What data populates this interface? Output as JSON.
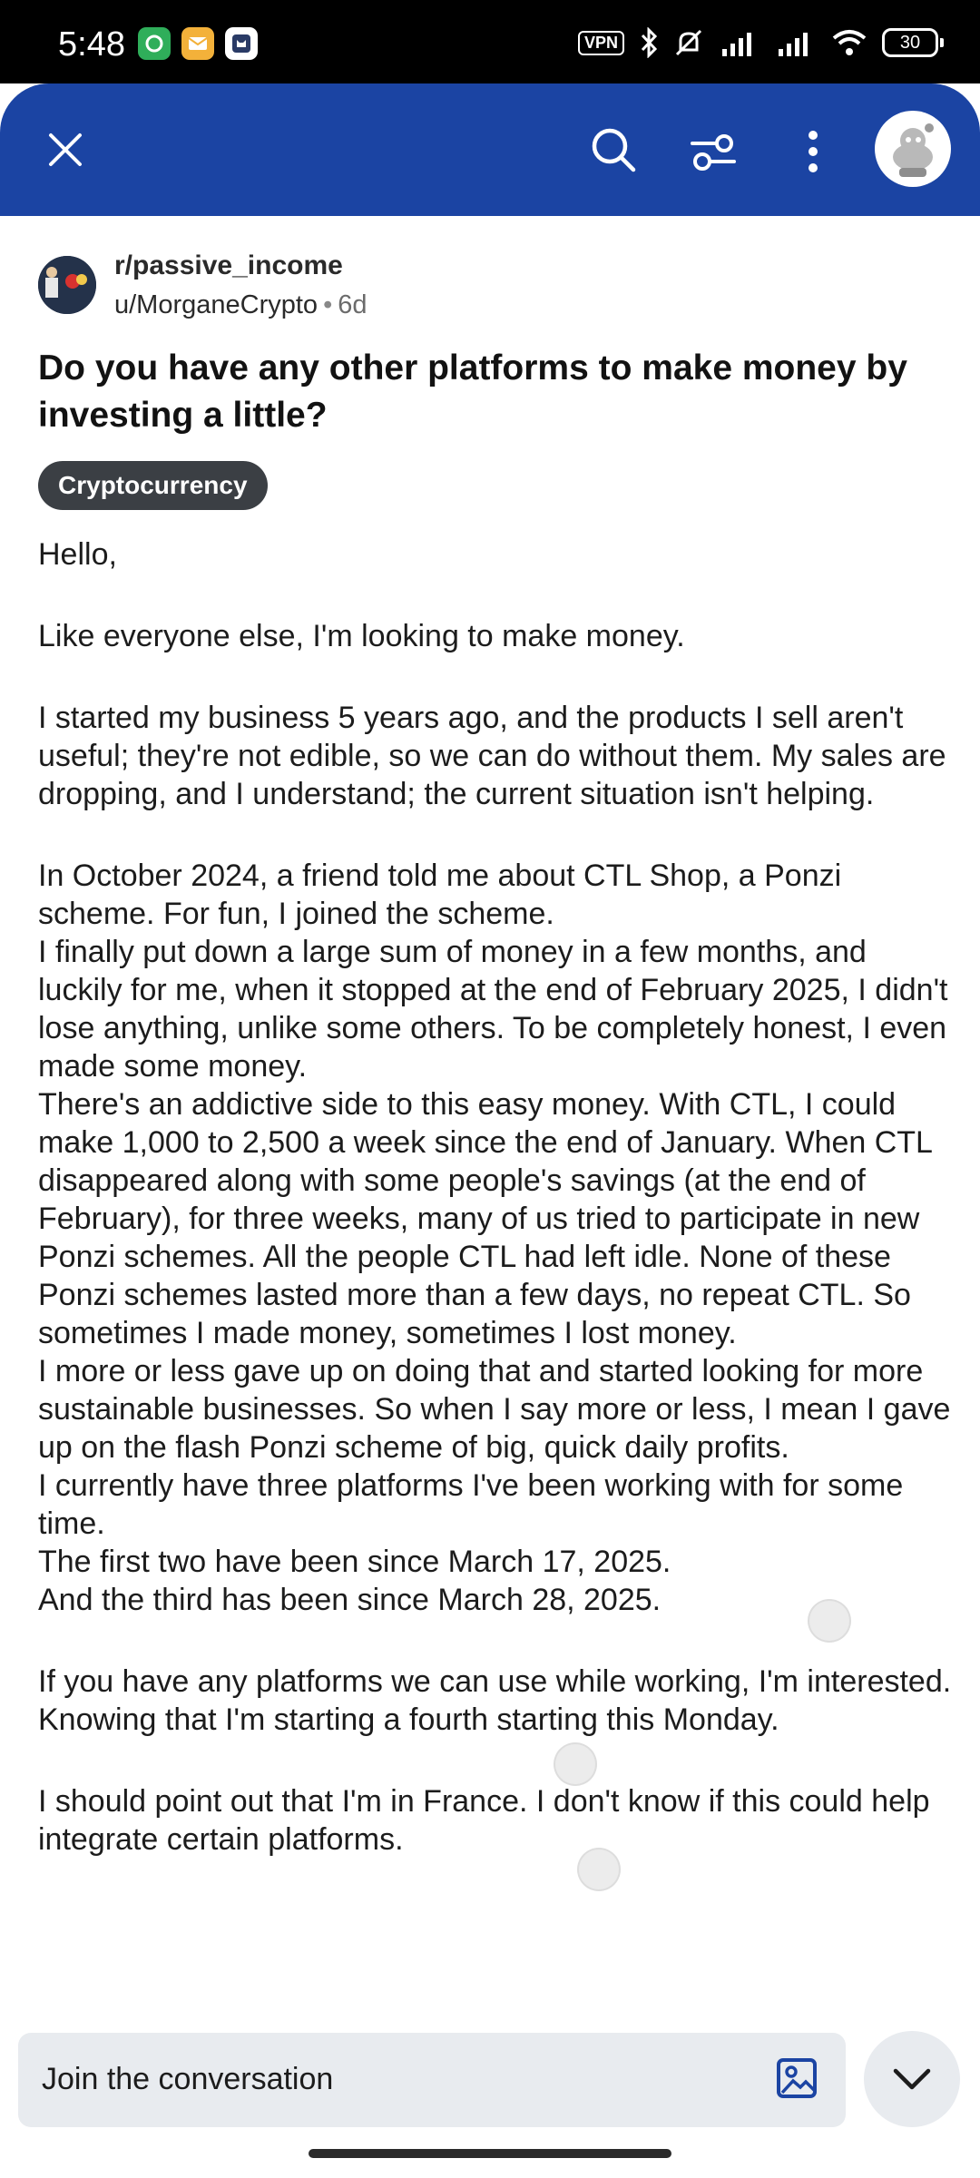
{
  "status_bar": {
    "time": "5:48",
    "vpn_label": "VPN",
    "battery": "30"
  },
  "appbar": {
    "icons": [
      "close-icon",
      "search-icon",
      "filter-icon",
      "more-vertical-icon",
      "avatar-snoo-icon"
    ],
    "color": "#1b44a3"
  },
  "post": {
    "subreddit": "r/passive_income",
    "author": "u/MorganeCrypto",
    "age": "6d",
    "title": "Do you have any other platforms to make money by investing a little?",
    "flair": "Cryptocurrency",
    "paragraphs": [
      "Hello,",
      "Like everyone else, I'm looking to make money.",
      "I started my business 5 years ago, and the products I sell aren't useful; they're not edible, so we can do without them. My sales are dropping, and I understand; the current situation isn't helping.",
      "In October 2024, a friend told me about CTL Shop, a Ponzi scheme. For fun, I joined the scheme.\nI finally put down a large sum of money in a few months, and luckily for me, when it stopped at the end of February 2025, I didn't lose anything, unlike some others. To be completely honest, I even made some money.\nThere's an addictive side to this easy money. With CTL, I could make 1,000 to 2,500 a week since the end of January. When CTL disappeared along with some people's savings (at the end of February), for three weeks, many of us tried to participate in new Ponzi schemes. All the people CTL had left idle. None of these Ponzi schemes lasted more than a few days, no repeat CTL. So sometimes I made money, sometimes I lost money.\nI more or less gave up on doing that and started looking for more sustainable businesses. So when I say more or less, I mean I gave up on the flash Ponzi scheme of big, quick daily profits.\nI currently have three platforms I've been working with for some time.\nThe first two have been since March 17, 2025.\nAnd the third has been since March 28, 2025.",
      "If you have any platforms we can use while working, I'm interested.\nKnowing that I'm starting a fourth starting this Monday.",
      "I should point out that I'm in France. I don't know if this could help integrate certain platforms."
    ]
  },
  "composer": {
    "placeholder": "Join the conversation",
    "icons": [
      "image-icon",
      "chevron-down-icon"
    ]
  }
}
